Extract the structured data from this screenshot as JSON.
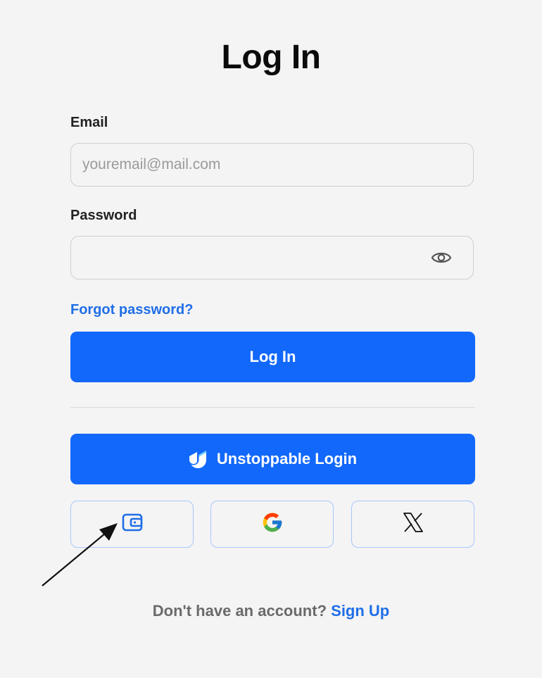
{
  "page": {
    "title": "Log In"
  },
  "form": {
    "email_label": "Email",
    "email_placeholder": "youremail@mail.com",
    "email_value": "",
    "password_label": "Password",
    "password_value": "",
    "forgot_password": "Forgot password?",
    "login_button": "Log In"
  },
  "alt_login": {
    "unstoppable_button": "Unstoppable Login",
    "unstoppable_icon": "unstoppable-logo-icon",
    "social_buttons": [
      {
        "name": "wallet",
        "icon": "wallet-icon"
      },
      {
        "name": "google",
        "icon": "google-icon"
      },
      {
        "name": "x",
        "icon": "x-logo-icon"
      }
    ]
  },
  "footer": {
    "prompt": "Don't have an account?",
    "signup_link": "Sign Up"
  },
  "colors": {
    "background": "#f4f4f4",
    "primary": "#1268fb",
    "link": "#1f6ee8",
    "social_border": "#a9c6fb"
  },
  "annotations": {
    "arrow_target": "wallet-login-button"
  }
}
